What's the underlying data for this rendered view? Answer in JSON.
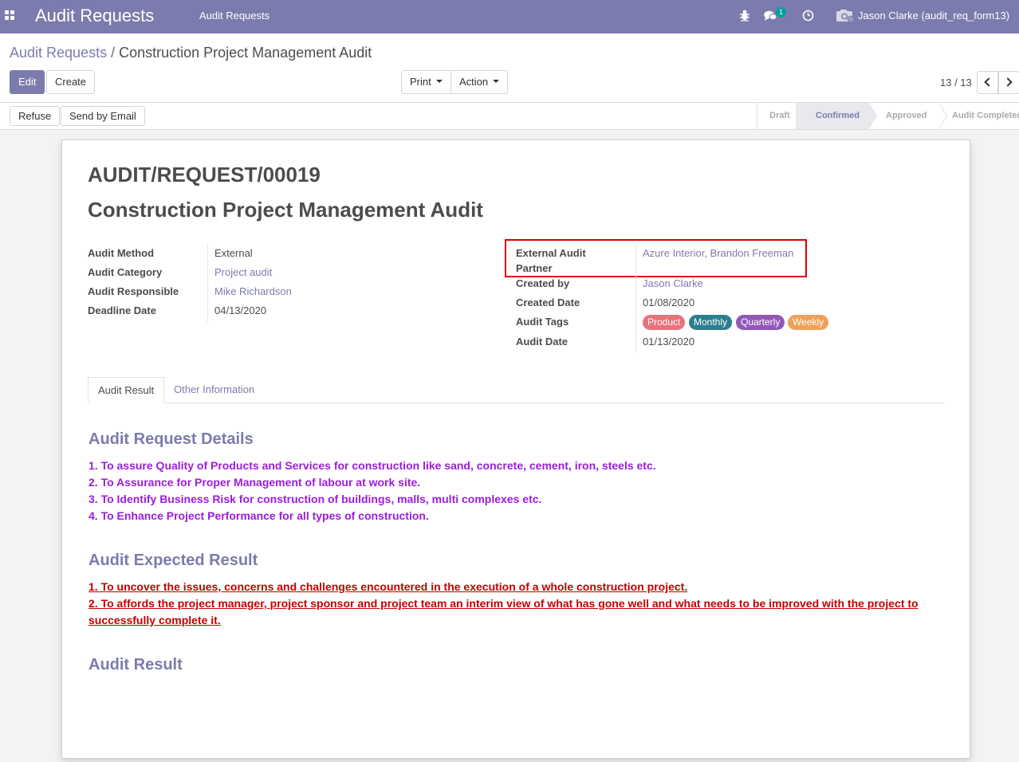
{
  "navbar": {
    "app_title": "Audit Requests",
    "menu_item": "Audit Requests",
    "chat_badge": "1",
    "user_name": "Jason Clarke (audit_req_form13)",
    "icons": [
      "apps-icon",
      "bug-icon",
      "chat-icon",
      "clock-icon",
      "camera-icon"
    ]
  },
  "breadcrumb": {
    "parent": "Audit Requests",
    "separator": "/",
    "current": "Construction Project Management Audit"
  },
  "toolbar": {
    "edit_label": "Edit",
    "create_label": "Create",
    "print_label": "Print",
    "action_label": "Action",
    "pager_label": "13 / 13"
  },
  "statusbar": {
    "refuse_label": "Refuse",
    "send_email_label": "Send by Email",
    "steps": [
      "Draft",
      "Confirmed",
      "Approved",
      "Audit Completed"
    ],
    "active_step": "Confirmed"
  },
  "record": {
    "reference": "AUDIT/REQUEST/00019",
    "title": "Construction Project Management Audit",
    "left_fields": [
      {
        "label": "Audit Method",
        "value": "External"
      },
      {
        "label": "Audit Category",
        "value": "Project audit"
      },
      {
        "label": "Audit Responsible",
        "value": "Mike Richardson"
      },
      {
        "label": "Deadline Date",
        "value": "04/13/2020"
      }
    ],
    "right_fields": {
      "partner_label_line1": "External Audit",
      "partner_label_line2": "Partner",
      "partner_value": "Azure Interior, Brandon Freeman",
      "created_by_label": "Created by",
      "created_by_value": "Jason Clarke",
      "created_date_label": "Created Date",
      "created_date_value": "01/08/2020",
      "tags_label": "Audit Tags",
      "audit_date_label": "Audit Date",
      "audit_date_value": "01/13/2020"
    },
    "tags": [
      {
        "label": "Product",
        "color": "#e8737a"
      },
      {
        "label": "Monthly",
        "color": "#2b7f8f"
      },
      {
        "label": "Quarterly",
        "color": "#9357b8"
      },
      {
        "label": "Weekly",
        "color": "#f0a05a"
      }
    ]
  },
  "tabs": [
    "Audit Result",
    "Other Information"
  ],
  "content": {
    "details_heading": "Audit Request Details",
    "details_lines": [
      "1. To assure Quality of Products and Services for construction like sand, concrete, cement, iron, steels etc.",
      "2. To Assurance for Proper Management of labour at work site.",
      "3. To Identify Business Risk for construction of buildings, malls, multi complexes etc.",
      "4. To Enhance Project Performance for all types of construction."
    ],
    "expected_heading": "Audit Expected Result",
    "expected_lines": [
      "1. To uncover the issues, concerns and challenges encountered in the execution of a  whole construction project.",
      "2. To affords the project manager, project sponsor and project team an interim view of what has gone well and what needs to be improved with the project to",
      "successfully complete it."
    ],
    "result_heading": "Audit Result"
  },
  "colors": {
    "brand": "#7c7bad",
    "details_text": "#9c1cdc",
    "expected_text": "#c40000",
    "highlight_border": "#e00000"
  }
}
